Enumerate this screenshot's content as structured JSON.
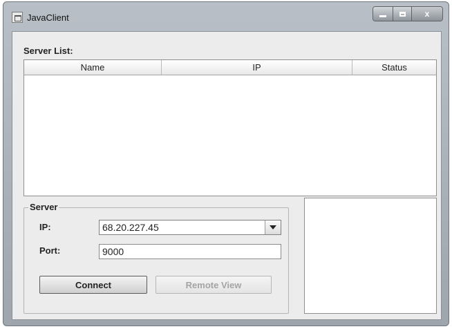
{
  "window": {
    "title": "JavaClient",
    "controls": {
      "close_glyph": "x"
    }
  },
  "server_list": {
    "label": "Server List:",
    "columns": [
      "Name",
      "IP",
      "Status"
    ],
    "rows": []
  },
  "server_panel": {
    "legend": "Server",
    "ip_label": "IP:",
    "ip_value": "68.20.227.45",
    "port_label": "Port:",
    "port_value": "9000",
    "connect_label": "Connect",
    "remote_view_label": "Remote View"
  },
  "icons": {
    "app": "java-window-icon",
    "minimize": "minimize-icon",
    "maximize": "maximize-icon",
    "close": "close-icon",
    "dropdown": "chevron-down-icon"
  }
}
